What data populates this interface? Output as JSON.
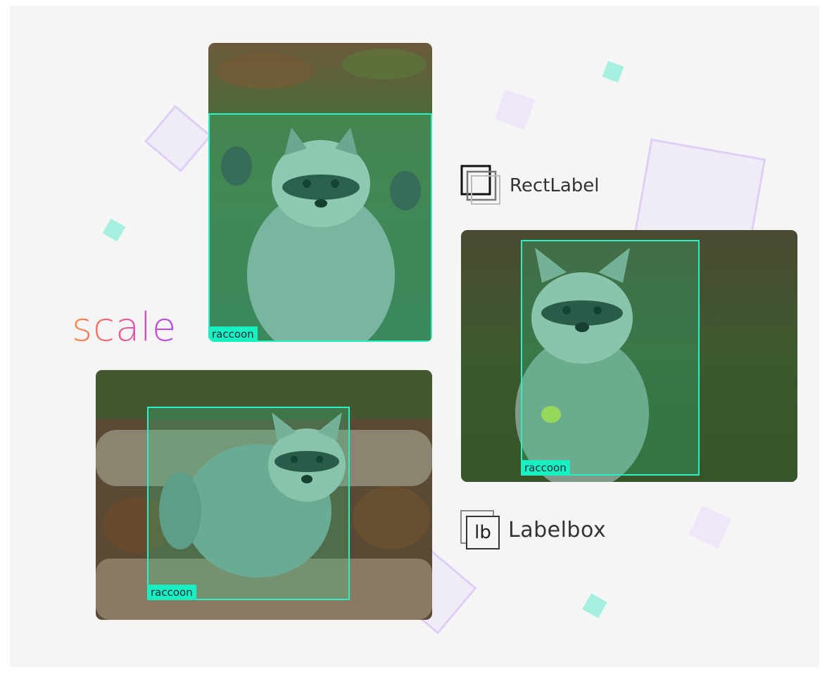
{
  "logos": {
    "scale": "scale",
    "rectlabel": "RectLabel",
    "labelbox": "Labelbox",
    "labelbox_mark": "lb"
  },
  "annotations": [
    {
      "label": "raccoon"
    },
    {
      "label": "raccoon"
    },
    {
      "label": "raccoon"
    }
  ],
  "colors": {
    "bbox": "#2af0c8",
    "tag": "#18f0c4",
    "deco_purple": "#e0cff5",
    "deco_teal": "#a6f0df"
  }
}
